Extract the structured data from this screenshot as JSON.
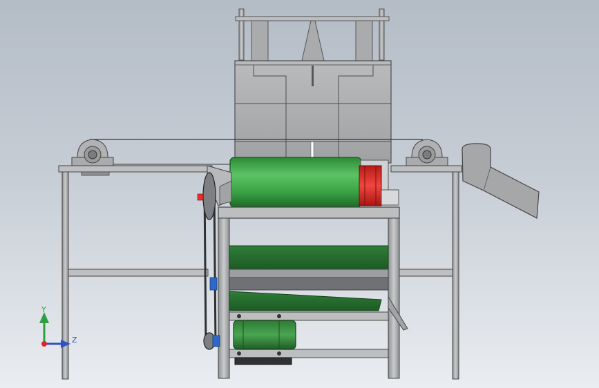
{
  "viewport": {
    "background_top": "#b4bcc6",
    "background_bottom": "#eaedf1"
  },
  "colors": {
    "steel": "#9c9ea0",
    "steel_dark": "#55575a",
    "steel_light": "#c4c6c8",
    "drum_green": "#3fa84a",
    "drum_green_dark": "#1f6a29",
    "pulley_red": "#e4312b",
    "pulley_blue": "#2f68c8",
    "axis_x": "#d9262b",
    "axis_y": "#2ea043",
    "axis_z": "#2e52c8"
  },
  "triad": {
    "y_label": "Y",
    "z_label": "Z"
  }
}
